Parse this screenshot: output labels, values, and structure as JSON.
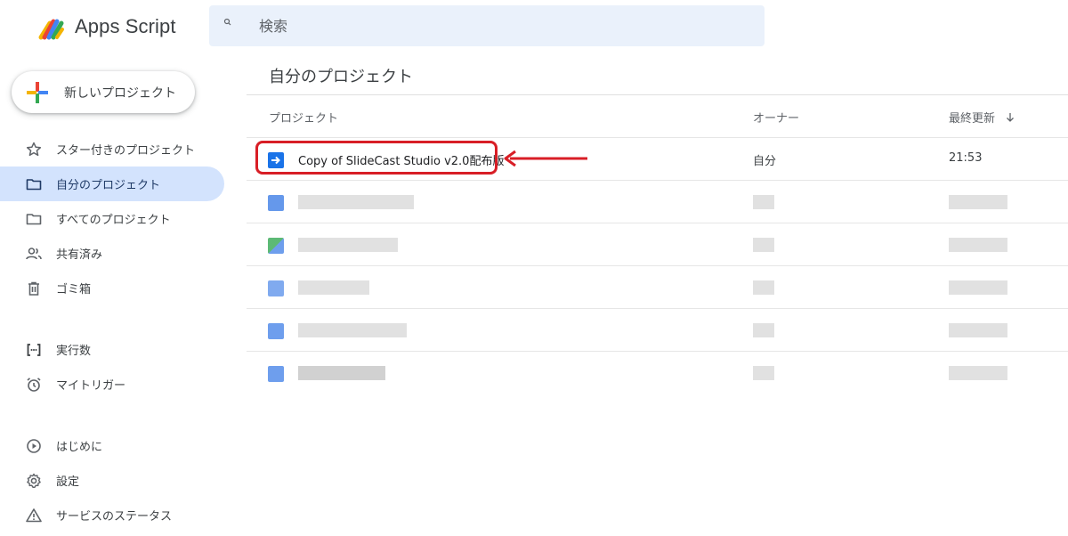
{
  "app": {
    "title": "Apps Script"
  },
  "search": {
    "placeholder": "検索"
  },
  "sidebar": {
    "new_project_label": "新しいプロジェクト",
    "items": [
      {
        "label": "スター付きのプロジェクト",
        "icon": "star-icon"
      },
      {
        "label": "自分のプロジェクト",
        "icon": "folder-icon",
        "active": true
      },
      {
        "label": "すべてのプロジェクト",
        "icon": "folder-icon"
      },
      {
        "label": "共有済み",
        "icon": "people-icon"
      },
      {
        "label": "ゴミ箱",
        "icon": "trash-icon"
      }
    ],
    "items2": [
      {
        "label": "実行数",
        "icon": "executions-icon"
      },
      {
        "label": "マイトリガー",
        "icon": "alarm-icon"
      }
    ],
    "items3": [
      {
        "label": "はじめに",
        "icon": "play-circle-icon"
      },
      {
        "label": "設定",
        "icon": "gear-icon"
      },
      {
        "label": "サービスのステータス",
        "icon": "warning-icon"
      }
    ]
  },
  "main": {
    "title": "自分のプロジェクト",
    "columns": {
      "project": "プロジェクト",
      "owner": "オーナー",
      "updated": "最終更新",
      "sort_icon": "arrow-down-icon"
    },
    "rows": [
      {
        "name": "Copy of SlideCast Studio v2.0配布版",
        "owner": "自分",
        "updated": "21:53",
        "icon": "apps-script-file-icon"
      }
    ]
  },
  "colors": {
    "accent": "#1a73e8",
    "active_nav": "#d3e3fd",
    "search_bg": "#eaf1fb",
    "highlight": "#d81e26"
  }
}
